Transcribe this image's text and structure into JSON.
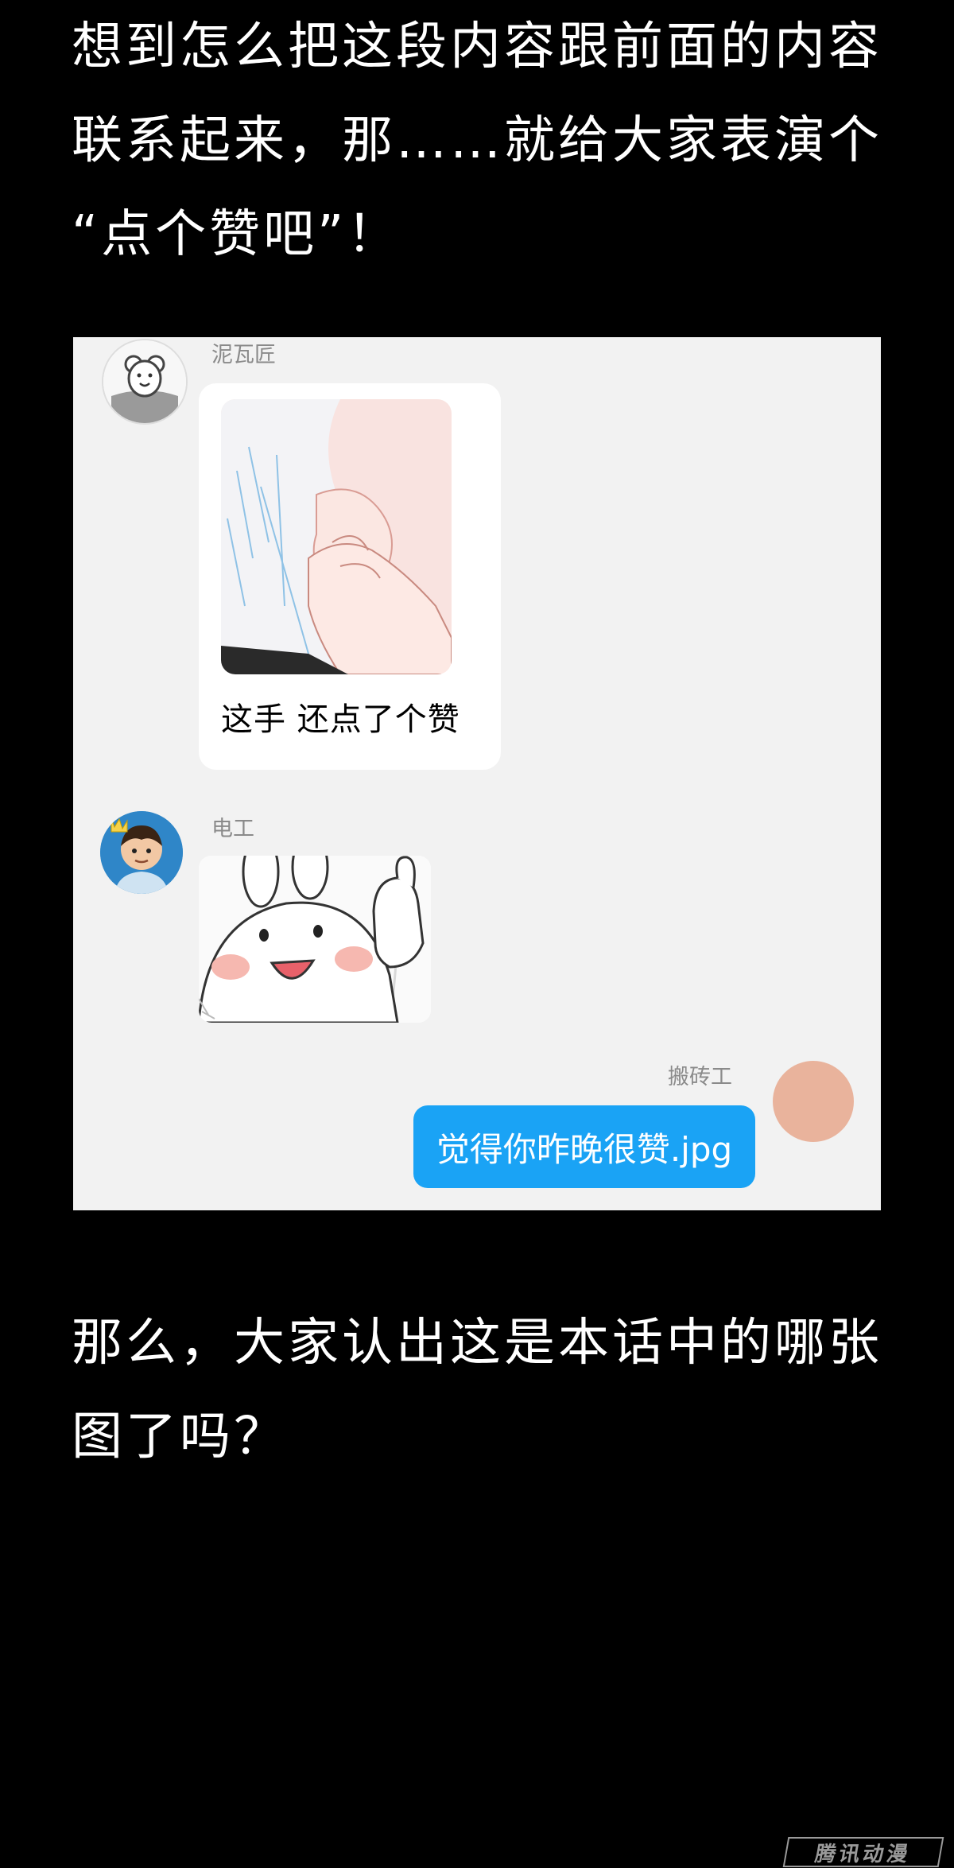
{
  "intro": {
    "lines": [
      "想到怎么把这段内容跟前面的内容",
      "联系起来，那……就给大家表演个",
      "“点个赞吧”！"
    ]
  },
  "chat": {
    "messages": [
      {
        "sender": "泥瓦匠",
        "caption": "这手  还点了个赞"
      },
      {
        "sender": "电工"
      },
      {
        "sender": "搬砖工",
        "text": "觉得你昨晚很赞.jpg"
      }
    ]
  },
  "outro": {
    "lines": [
      "那么，大家认出这是本话中的哪张",
      "图了吗？"
    ]
  },
  "watermark": "腾讯动漫",
  "colors": {
    "blue_bubble": "#1aa3f5",
    "avatar_peach": "#e9b39c",
    "chat_bg": "#f2f2f2"
  }
}
